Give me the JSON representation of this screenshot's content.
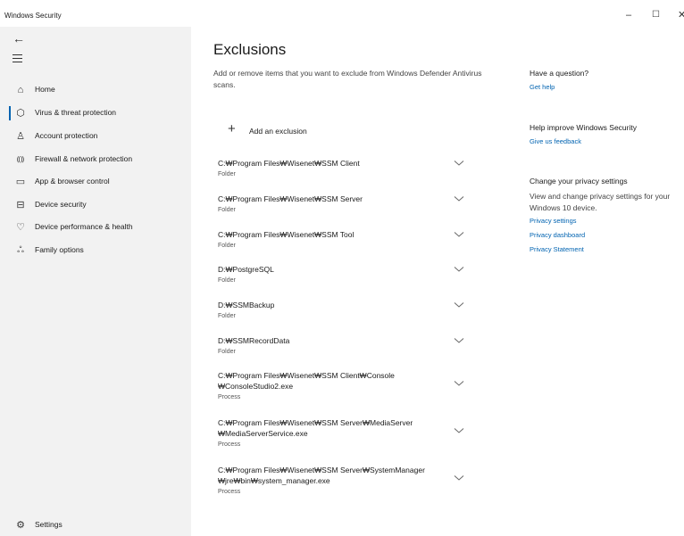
{
  "window": {
    "title": "Windows Security",
    "minimize": "–",
    "maximize": "☐",
    "close": "✕"
  },
  "sidebar": {
    "back_icon": "←",
    "items": [
      {
        "label": "Home",
        "icon": "⌂",
        "icon_name": "home-icon"
      },
      {
        "label": "Virus & threat protection",
        "icon": "⬡",
        "icon_name": "shield-icon",
        "selected": true
      },
      {
        "label": "Account protection",
        "icon": "♙",
        "icon_name": "person-icon"
      },
      {
        "label": "Firewall & network protection",
        "icon": "⸨⸩",
        "icon_name": "wireless-icon"
      },
      {
        "label": "App & browser control",
        "icon": "▭",
        "icon_name": "browser-window-icon"
      },
      {
        "label": "Device security",
        "icon": "⊟",
        "icon_name": "laptop-icon"
      },
      {
        "label": "Device performance & health",
        "icon": "♡",
        "icon_name": "heart-icon"
      },
      {
        "label": "Family options",
        "icon": "ஃ",
        "icon_name": "family-icon"
      }
    ],
    "settings": {
      "label": "Settings",
      "icon": "⚙",
      "icon_name": "gear-icon"
    }
  },
  "main": {
    "title": "Exclusions",
    "description": "Add or remove items that you want to exclude from Windows Defender Antivirus scans.",
    "add_button": {
      "icon": "+",
      "label": "Add an exclusion"
    },
    "exclusions": [
      {
        "lines": [
          "C:₩Program Files₩Wisenet₩SSM Client"
        ],
        "type": "Folder"
      },
      {
        "lines": [
          "C:₩Program Files₩Wisenet₩SSM Server"
        ],
        "type": "Folder"
      },
      {
        "lines": [
          "C:₩Program Files₩Wisenet₩SSM Tool"
        ],
        "type": "Folder"
      },
      {
        "lines": [
          "D:₩PostgreSQL"
        ],
        "type": "Folder"
      },
      {
        "lines": [
          "D:₩SSMBackup"
        ],
        "type": "Folder"
      },
      {
        "lines": [
          "D:₩SSMRecordData"
        ],
        "type": "Folder"
      },
      {
        "lines": [
          "C:₩Program Files₩Wisenet₩SSM Client₩Console",
          "₩ConsoleStudio2.exe"
        ],
        "type": "Process"
      },
      {
        "lines": [
          "C:₩Program Files₩Wisenet₩SSM Server₩MediaServer",
          "₩MediaServerService.exe"
        ],
        "type": "Process"
      },
      {
        "lines": [
          "C:₩Program Files₩Wisenet₩SSM Server₩SystemManager",
          "₩jre₩bin₩system_manager.exe"
        ],
        "type": "Process"
      }
    ]
  },
  "right_panel": {
    "question": {
      "heading": "Have a question?",
      "link": "Get help"
    },
    "improve": {
      "heading": "Help improve Windows Security",
      "link": "Give us feedback"
    },
    "privacy": {
      "heading": "Change your privacy settings",
      "text": "View and change privacy settings for your Windows 10 device.",
      "links": [
        "Privacy settings",
        "Privacy dashboard",
        "Privacy Statement"
      ]
    }
  },
  "colors": {
    "accent": "#0063b1",
    "sidebar_bg": "#f2f2f2"
  }
}
